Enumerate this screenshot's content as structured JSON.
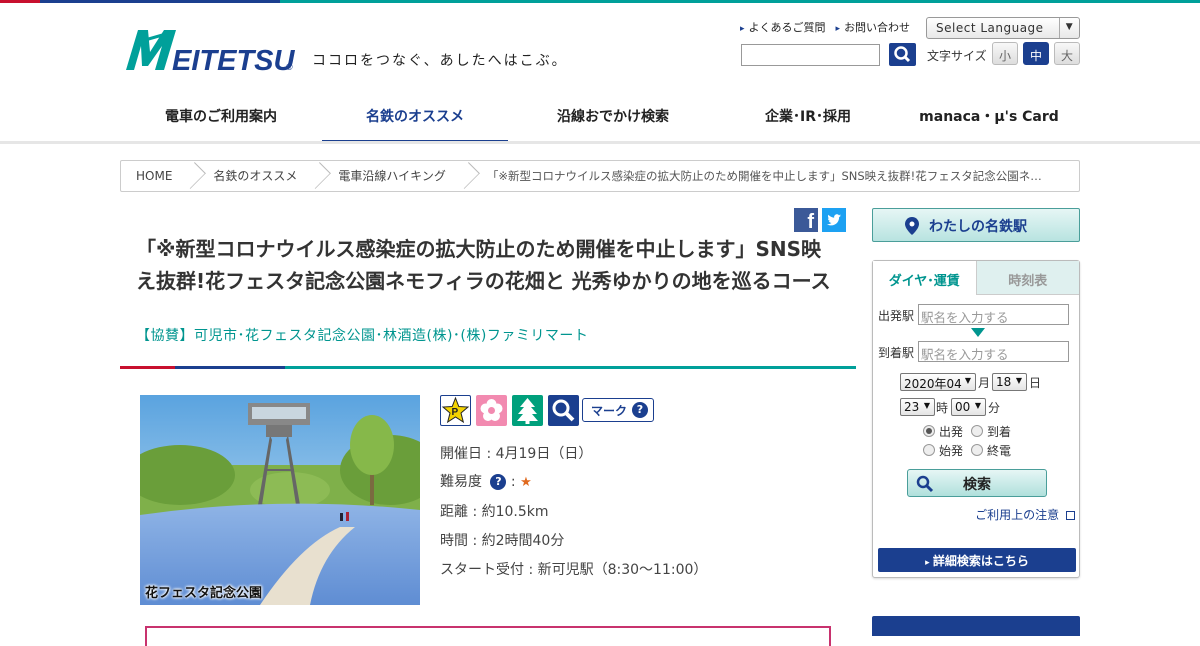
{
  "header": {
    "logo_text": "MEITETSU",
    "tagline": "ココロをつなぐ、あしたへはこぶ。",
    "util_links": [
      "よくあるご質問",
      "お問い合わせ"
    ],
    "language_select": "Select Language",
    "font_size_label": "文字サイズ",
    "font_sizes": [
      "小",
      "中",
      "大"
    ],
    "active_font_size": "中"
  },
  "nav": {
    "items": [
      "電車のご利用案内",
      "名鉄のオススメ",
      "沿線おでかけ検索",
      "企業･IR･採用",
      "manaca・μ's Card"
    ],
    "active": "名鉄のオススメ"
  },
  "breadcrumb": [
    "HOME",
    "名鉄のオススメ",
    "電車沿線ハイキング",
    "「※新型コロナウイルス感染症の拡大防止のため開催を中止します」SNS映え抜群!花フェスタ記念公園ネ…"
  ],
  "article": {
    "title": "「※新型コロナウイルス感染症の拡大防止のため開催を中止します」SNS映え抜群!花フェスタ記念公園ネモフィラの花畑と 光秀ゆかりの地を巡るコース",
    "sponsor": "【協賛】可児市･花フェスタ記念公園･林酒造(株)･(株)ファミリマート",
    "photo_caption": "花フェスタ記念公園",
    "mark_button": "マーク",
    "date": "開催日 : 4月19日（日）",
    "difficulty_label": "難易度",
    "difficulty_stars": "★",
    "distance": "距離 : 約10.5km",
    "duration": "時間 : 約2時間40分",
    "start": "スタート受付 : 新可児駅（8:30～11:00）"
  },
  "sidebar": {
    "my_station": "わたしの名鉄駅",
    "tabs": [
      "ダイヤ･運賃",
      "時刻表"
    ],
    "departure_label": "出発駅",
    "arrival_label": "到着駅",
    "station_placeholder": "駅名を入力する",
    "year_month": "2020年04",
    "month_unit": "月",
    "day": "18",
    "day_unit": "日",
    "hour": "23",
    "hour_unit": "時",
    "minute": "00",
    "minute_unit": "分",
    "radios": [
      "出発",
      "到着",
      "始発",
      "終電"
    ],
    "selected_radio": "出発",
    "search_button": "検索",
    "notice_link": "ご利用上の注意",
    "detail_button": "詳細検索はこちら"
  }
}
